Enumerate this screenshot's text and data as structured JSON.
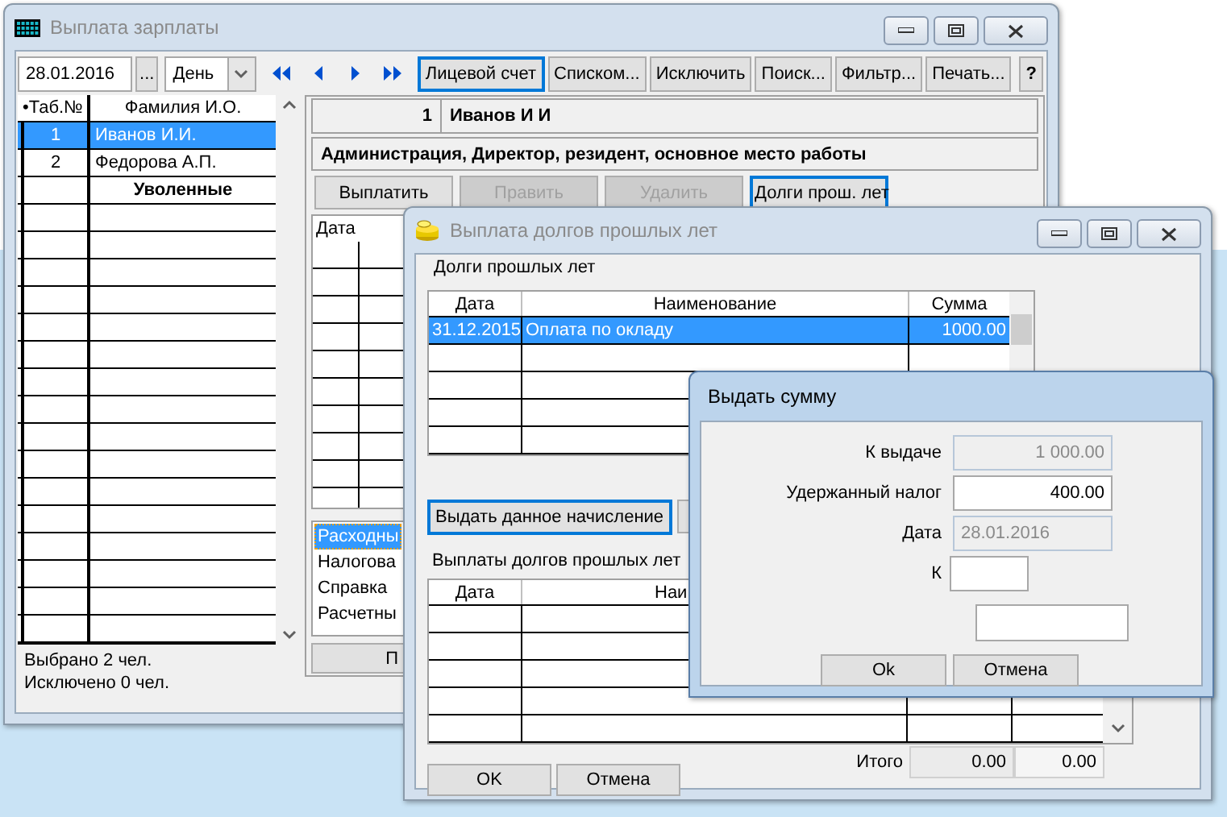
{
  "main_window": {
    "title": "Выплата зарплаты",
    "toolbar": {
      "date": "28.01.2016",
      "browse_button": "...",
      "period": "День",
      "buttons": [
        {
          "label": "Лицевой счет",
          "focused": true
        },
        {
          "label": "Списком...",
          "focused": false
        },
        {
          "label": "Исключить",
          "focused": false
        },
        {
          "label": "Поиск...",
          "focused": false
        },
        {
          "label": "Фильтр...",
          "focused": false
        },
        {
          "label": "Печать...",
          "focused": false
        },
        {
          "label": "?",
          "focused": false
        }
      ]
    },
    "employee_list": {
      "columns": [
        "•Таб.№",
        "Фамилия И.О."
      ],
      "rows": [
        {
          "number": "1",
          "name": "Иванов И.И.",
          "selected": true
        },
        {
          "number": "2",
          "name": "Федорова А.П.",
          "selected": false
        }
      ],
      "group_row": "Уволенные"
    },
    "status": [
      "Выбрано 2 чел.",
      "Исключено 0 чел."
    ],
    "employee_header": {
      "number": "1",
      "name": "Иванов И И",
      "position": "Администрация, Директор, резидент, основное место работы"
    },
    "actions": [
      {
        "label": "Выплатить",
        "disabled": false,
        "focused": false
      },
      {
        "label": "Править",
        "disabled": true,
        "focused": false
      },
      {
        "label": "Удалить",
        "disabled": true,
        "focused": false
      },
      {
        "label": "Долги прош. лет",
        "disabled": false,
        "focused": true
      }
    ],
    "payments_table": {
      "columns": [
        "Дата"
      ]
    },
    "documents": [
      {
        "label": "Расходны",
        "selected": true
      },
      {
        "label": "Налогова",
        "selected": false
      },
      {
        "label": "Справка",
        "selected": false
      },
      {
        "label": "Расчетны",
        "selected": false
      }
    ],
    "bottom_button": "П"
  },
  "debts_window": {
    "title": "Выплата долгов прошлых лет",
    "debts_label": "Долги прошлых лет",
    "debts_table": {
      "columns": [
        "Дата",
        "Наименование",
        "Сумма"
      ],
      "rows": [
        {
          "date": "31.12.2015",
          "name": "Оплата по окладу",
          "amount": "1000.00",
          "selected": true
        }
      ]
    },
    "issue_button": {
      "label": "Выдать данное начисление",
      "focused": true
    },
    "payments_label": "Выплаты долгов прошлых лет",
    "payments_table": {
      "columns": [
        "Дата",
        "Наи"
      ]
    },
    "total_label": "Итого",
    "totals": [
      "0.00",
      "0.00"
    ],
    "buttons": [
      "OK",
      "Отмена"
    ]
  },
  "issue_dialog": {
    "title": "Выдать сумму",
    "fields": [
      {
        "kind": "amount",
        "label": "К выдаче",
        "value": "1 000.00",
        "disabled": true
      },
      {
        "kind": "amount",
        "label": "Удержанный налог",
        "value": "400.00",
        "disabled": false
      },
      {
        "kind": "date",
        "label": "Дата",
        "value": "28.01.2016",
        "disabled": true
      },
      {
        "kind": "short",
        "label": "К",
        "disabled": false
      },
      {
        "kind": "wide",
        "disabled": false
      }
    ],
    "buttons": [
      "Ok",
      "Отмена"
    ]
  }
}
